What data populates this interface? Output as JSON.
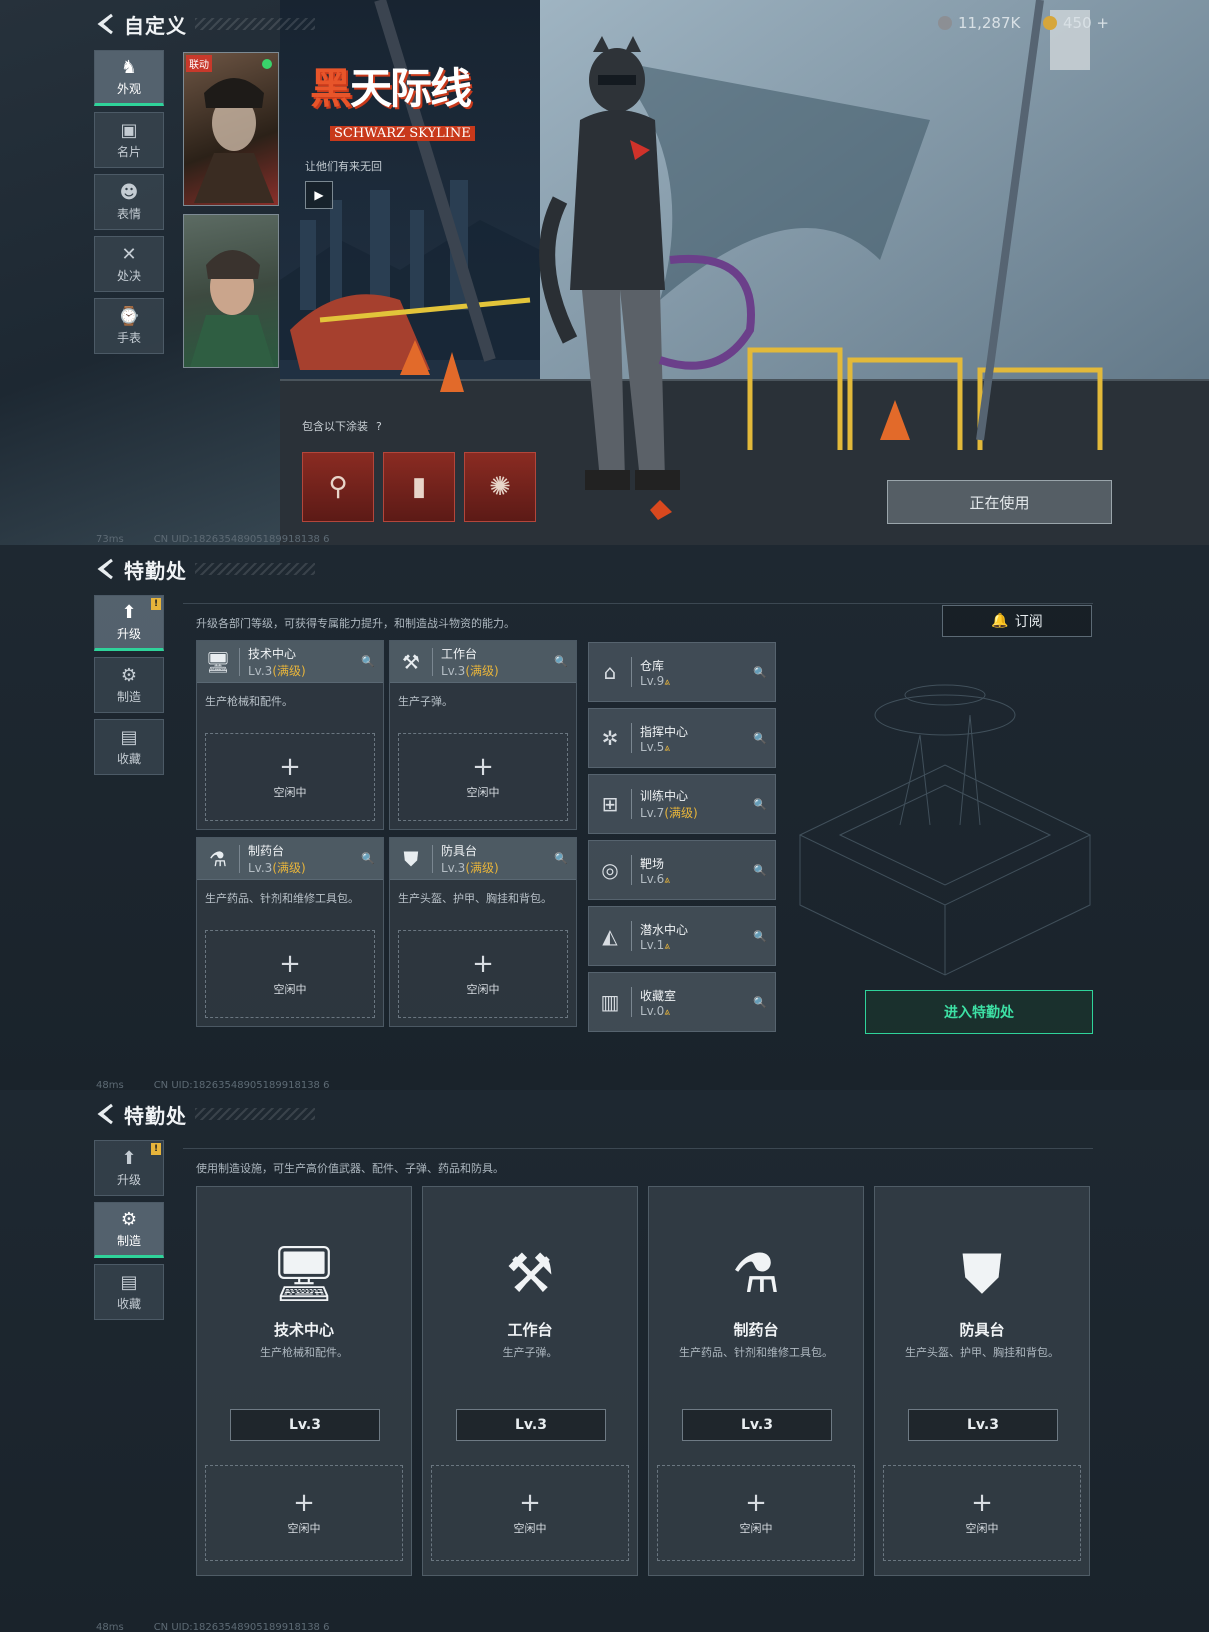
{
  "panel1": {
    "title": "自定义",
    "nav": [
      {
        "label": "外观",
        "icon": "outfit-icon",
        "glyph": "♞"
      },
      {
        "label": "名片",
        "icon": "card-icon",
        "glyph": "▣"
      },
      {
        "label": "表情",
        "icon": "emote-icon",
        "glyph": "☻"
      },
      {
        "label": "处决",
        "icon": "execution-icon",
        "glyph": "✕"
      },
      {
        "label": "手表",
        "icon": "watch-icon",
        "glyph": "⌚"
      }
    ],
    "collab_tag": "联动",
    "logo_cn_1": "黑",
    "logo_cn_2": "天际线",
    "logo_en": "SCHWARZ SKYLINE",
    "slogan": "让他们有来无回",
    "includes_label": "包含以下涂装",
    "includes_help": "?",
    "currency_1": "11,287K",
    "currency_2": "450 +",
    "use_button": "正在使用",
    "ping": "73ms",
    "uid": "CN UID:18263548905189918138 6"
  },
  "panel2": {
    "title": "特勤处",
    "nav": [
      {
        "label": "升级",
        "icon": "upgrade-icon",
        "glyph": "⬆",
        "badge": "!"
      },
      {
        "label": "制造",
        "icon": "craft-icon",
        "glyph": "⚙"
      },
      {
        "label": "收藏",
        "icon": "collection-icon",
        "glyph": "▤"
      }
    ],
    "description": "升级各部门等级，可获得专属能力提升，和制造战斗物资的能力。",
    "subscribe": "订阅",
    "large_facilities": [
      {
        "name": "技术中心",
        "level": "Lv.3",
        "max": "(满级)",
        "desc": "生产枪械和配件。",
        "icon": "tech-center-icon",
        "glyph": "🖥",
        "idle": "空闲中"
      },
      {
        "name": "工作台",
        "level": "Lv.3",
        "max": "(满级)",
        "desc": "生产子弹。",
        "icon": "workbench-icon",
        "glyph": "⚒",
        "idle": "空闲中"
      },
      {
        "name": "制药台",
        "level": "Lv.3",
        "max": "(满级)",
        "desc": "生产药品、针剂和维修工具包。",
        "icon": "pharmacy-icon",
        "glyph": "⚗",
        "idle": "空闲中"
      },
      {
        "name": "防具台",
        "level": "Lv.3",
        "max": "(满级)",
        "desc": "生产头盔、护甲、胸挂和背包。",
        "icon": "armor-icon",
        "glyph": "⛊",
        "idle": "空闲中"
      }
    ],
    "small_facilities": [
      {
        "name": "仓库",
        "level": "Lv.9",
        "max": "",
        "icon": "warehouse-icon",
        "glyph": "⌂"
      },
      {
        "name": "指挥中心",
        "level": "Lv.5",
        "max": "",
        "icon": "command-icon",
        "glyph": "✲"
      },
      {
        "name": "训练中心",
        "level": "Lv.7",
        "max": "(满级)",
        "icon": "training-icon",
        "glyph": "⊞"
      },
      {
        "name": "靶场",
        "level": "Lv.6",
        "max": "",
        "icon": "range-icon",
        "glyph": "◎"
      },
      {
        "name": "潜水中心",
        "level": "Lv.1",
        "max": "",
        "icon": "dive-icon",
        "glyph": "◭"
      },
      {
        "name": "收藏室",
        "level": "Lv.0",
        "max": "",
        "icon": "collection-room-icon",
        "glyph": "▥"
      }
    ],
    "up_glyph": "⩓",
    "enter_button": "进入特勤处",
    "ping": "48ms",
    "uid": "CN UID:18263548905189918138 6"
  },
  "panel3": {
    "title": "特勤处",
    "nav": [
      {
        "label": "升级",
        "icon": "upgrade-icon",
        "glyph": "⬆",
        "badge": "!"
      },
      {
        "label": "制造",
        "icon": "craft-icon",
        "glyph": "⚙"
      },
      {
        "label": "收藏",
        "icon": "collection-icon",
        "glyph": "▤"
      }
    ],
    "description": "使用制造设施，可生产高价值武器、配件、子弹、药品和防具。",
    "cards": [
      {
        "name": "技术中心",
        "desc": "生产枪械和配件。",
        "level": "Lv.3",
        "idle": "空闲中",
        "icon": "tech-center-icon",
        "glyph": "🖥"
      },
      {
        "name": "工作台",
        "desc": "生产子弹。",
        "level": "Lv.3",
        "idle": "空闲中",
        "icon": "workbench-icon",
        "glyph": "⚒"
      },
      {
        "name": "制药台",
        "desc": "生产药品、针剂和维修工具包。",
        "level": "Lv.3",
        "idle": "空闲中",
        "icon": "pharmacy-icon",
        "glyph": "⚗"
      },
      {
        "name": "防具台",
        "desc": "生产头盔、护甲、胸挂和背包。",
        "level": "Lv.3",
        "idle": "空闲中",
        "icon": "armor-icon",
        "glyph": "⛊"
      }
    ],
    "ping": "48ms",
    "uid": "CN UID:18263548905189918138 6"
  },
  "colors": {
    "accent": "#2fd39a",
    "gold": "#e7b43b",
    "brand_red": "#c8391b"
  }
}
